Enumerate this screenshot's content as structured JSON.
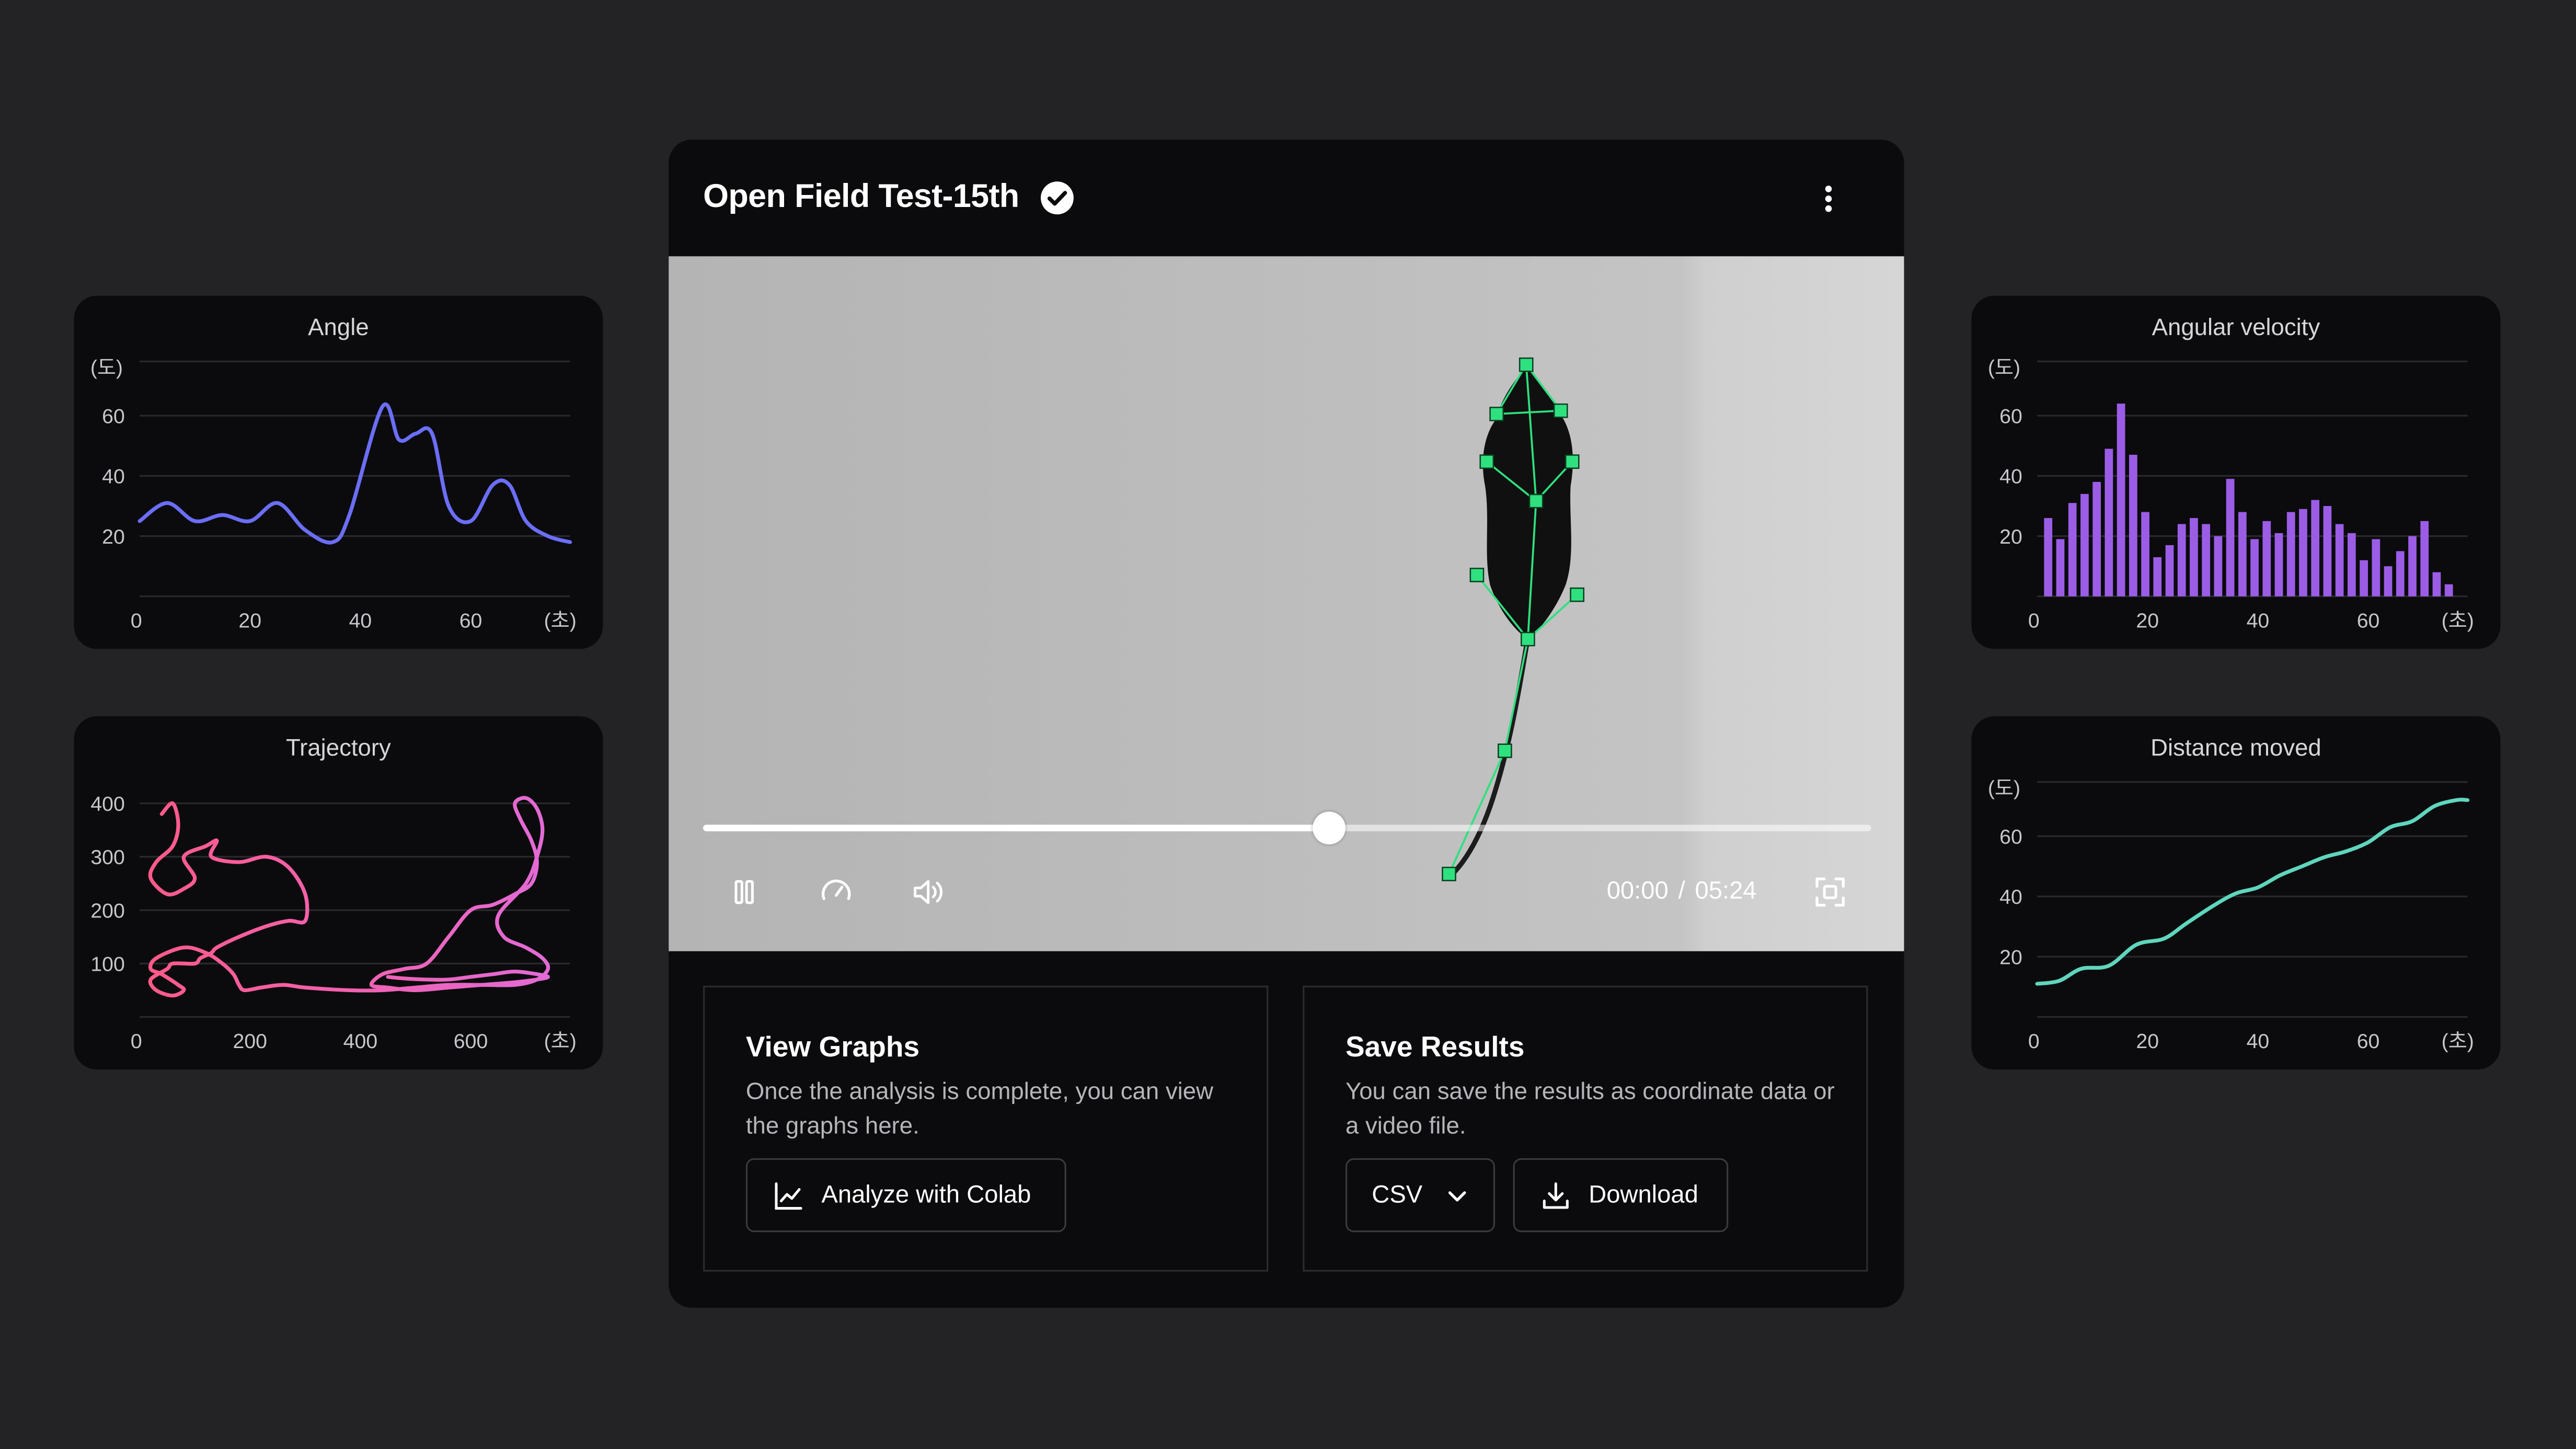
{
  "main": {
    "title": "Open Field Test-15th",
    "time_current": "00:00",
    "time_separator": "/",
    "time_total": "05:24",
    "progress": 0.536
  },
  "panels": {
    "view_graphs": {
      "title": "View Graphs",
      "description": "Once the analysis is complete, you can view the graphs here.",
      "button_label": "Analyze with Colab"
    },
    "save_results": {
      "title": "Save Results",
      "description": "You can save the results as coordinate data or a video file.",
      "format_selected": "CSV",
      "download_label": "Download"
    }
  },
  "colors": {
    "angle": "#6b6ef7",
    "angular_velocity": "#9b5de5",
    "distance": "#5ed6bd",
    "trajectory_start": "#ff5a8a",
    "trajectory_end": "#e26ad6",
    "keypoint": "#2fe07f"
  },
  "chart_data": [
    {
      "id": "angle",
      "type": "line",
      "title": "Angle",
      "ylabel": "(도)",
      "xlabel": "(초)",
      "xticks": [
        "0",
        "20",
        "40",
        "60"
      ],
      "yticks": [
        "20",
        "40",
        "60"
      ],
      "xlim": [
        0,
        78
      ],
      "ylim": [
        0,
        78
      ],
      "x": [
        0,
        5,
        10,
        15,
        20,
        25,
        30,
        35,
        38,
        44,
        47,
        50,
        53,
        56,
        60,
        64,
        67,
        70,
        74,
        78
      ],
      "y": [
        25,
        31,
        25,
        27,
        25,
        31,
        22,
        18,
        27,
        63,
        52,
        54,
        54,
        30,
        25,
        37,
        37,
        25,
        20,
        18
      ]
    },
    {
      "id": "angular_velocity",
      "type": "bar",
      "title": "Angular velocity",
      "ylabel": "(도)",
      "xlabel": "(초)",
      "xticks": [
        "0",
        "20",
        "40",
        "60"
      ],
      "yticks": [
        "20",
        "40",
        "60"
      ],
      "xlim": [
        0,
        78
      ],
      "ylim": [
        0,
        78
      ],
      "x": [
        2,
        4.2,
        6.4,
        8.6,
        10.8,
        13,
        15.2,
        17.4,
        19.6,
        21.8,
        24,
        26.2,
        28.4,
        30.6,
        32.8,
        35,
        37.2,
        39.4,
        41.6,
        43.8,
        46,
        48.2,
        50.4,
        52.6,
        54.8,
        57,
        59.2,
        61.4,
        63.6,
        65.8,
        68,
        70.2,
        72.4,
        74.6
      ],
      "values": [
        26,
        19,
        31,
        34,
        38,
        49,
        64,
        47,
        28,
        13,
        17,
        24,
        26,
        24,
        20,
        39,
        28,
        19,
        25,
        21,
        28,
        29,
        32,
        30,
        24,
        21,
        12,
        19,
        10,
        15,
        20,
        25,
        8,
        4
      ]
    },
    {
      "id": "trajectory",
      "type": "line",
      "title": "Trajectory",
      "xlabel": "(초)",
      "xticks": [
        "0",
        "200",
        "400",
        "600"
      ],
      "yticks": [
        "100",
        "200",
        "300",
        "400"
      ],
      "xlim": [
        0,
        780
      ],
      "ylim": [
        0,
        440
      ],
      "x": [
        40,
        60,
        70,
        60,
        30,
        20,
        50,
        80,
        100,
        80,
        120,
        140,
        130,
        180,
        230,
        270,
        300,
        300,
        270,
        230,
        180,
        140,
        130,
        110,
        100,
        60,
        50,
        20,
        30,
        60,
        80,
        70,
        40,
        20,
        30,
        80,
        120,
        150,
        170,
        180,
        190,
        220,
        260,
        300,
        380,
        440,
        500,
        560,
        620,
        680,
        720,
        740,
        730,
        700,
        660,
        650,
        700,
        720,
        730,
        720,
        700,
        680,
        690,
        710,
        720,
        710,
        680,
        640,
        600,
        560,
        520,
        480,
        440,
        420,
        450,
        500,
        560,
        620,
        680,
        720,
        740,
        720,
        680,
        640,
        600,
        560,
        520,
        480,
        450
      ],
      "y": [
        380,
        400,
        360,
        320,
        290,
        260,
        230,
        240,
        260,
        300,
        320,
        330,
        300,
        290,
        300,
        280,
        230,
        180,
        180,
        170,
        150,
        130,
        120,
        110,
        100,
        100,
        90,
        70,
        50,
        40,
        50,
        60,
        80,
        90,
        110,
        130,
        120,
        100,
        80,
        60,
        50,
        55,
        60,
        55,
        50,
        50,
        55,
        60,
        60,
        60,
        70,
        90,
        110,
        130,
        150,
        190,
        250,
        300,
        350,
        390,
        410,
        400,
        370,
        330,
        290,
        250,
        230,
        210,
        200,
        150,
        100,
        90,
        80,
        60,
        55,
        50,
        55,
        60,
        65,
        70,
        75,
        80,
        85,
        80,
        75,
        70,
        70,
        72,
        75
      ]
    },
    {
      "id": "distance",
      "type": "line",
      "title": "Distance moved",
      "ylabel": "(도)",
      "xlabel": "(초)",
      "xticks": [
        "0",
        "20",
        "40",
        "60"
      ],
      "yticks": [
        "20",
        "40",
        "60"
      ],
      "xlim": [
        0,
        78
      ],
      "ylim": [
        0,
        78
      ],
      "x": [
        0,
        4,
        8,
        13,
        18,
        23,
        27,
        32,
        36,
        40,
        44,
        48,
        52,
        56,
        60,
        64,
        68,
        72,
        76,
        78
      ],
      "y": [
        11,
        12,
        16,
        17,
        24,
        26,
        31,
        37,
        41,
        43,
        47,
        50,
        53,
        55,
        58,
        63,
        65,
        70,
        72,
        72
      ]
    }
  ]
}
